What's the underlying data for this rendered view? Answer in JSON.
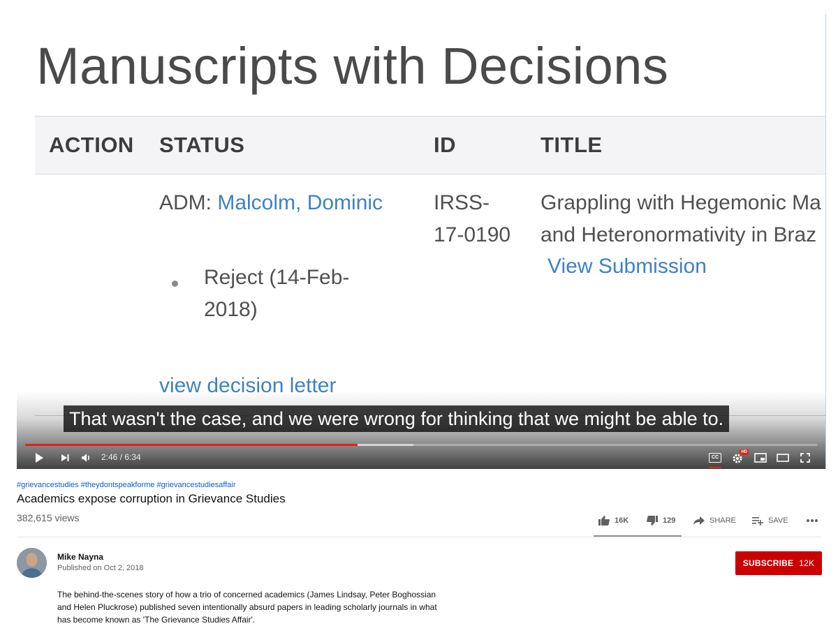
{
  "video": {
    "frame": {
      "heading": "Manuscripts with Decisions",
      "columns": [
        "ACTION",
        "STATUS",
        "ID",
        "TITLE"
      ],
      "row": {
        "status_prefix": "ADM: ",
        "status_name": "Malcolm, Dominic",
        "decision_line1": "Reject (14-Feb-",
        "decision_line2": "2018)",
        "decision_link": "view decision letter",
        "id_line1": "IRSS-",
        "id_line2": "17-0190",
        "title_line1": "Grappling with Hegemonic Ma",
        "title_line2": "and Heteronormativity in Braz",
        "title_link": "View Submission"
      }
    },
    "caption": "That wasn't the case, and we were wrong for thinking that we might be able to.",
    "time": "2:46 / 6:34",
    "progress_played_fraction": 0.42,
    "progress_buffered_fraction": 0.49,
    "controls": {
      "play_icon": "play-icon",
      "next_icon": "next-icon",
      "volume_icon": "volume-icon",
      "cc_label": "CC",
      "hd_label": "HD",
      "settings_icon": "gear-icon",
      "miniplayer_icon": "miniplayer-icon",
      "theater_icon": "theater-icon",
      "fullscreen_icon": "fullscreen-icon"
    },
    "accent_color": "#e62117"
  },
  "info": {
    "hashtags": "#grievancestudies #theydontspeakforme #grievancestudiesaffair",
    "title": "Academics expose corruption in Grievance Studies",
    "views": "382,615 views",
    "actions": {
      "likes": "16K",
      "dislikes": "129",
      "share": "SHARE",
      "save": "SAVE"
    }
  },
  "channel": {
    "name": "Mike Nayna",
    "published": "Published on Oct 2, 2018",
    "subscribe_label": "SUBSCRIBE",
    "subscriber_count": "12K",
    "subscribe_color": "#cc0000"
  },
  "description": "The behind-the-scenes story of how a trio of concerned academics (James Lindsay, Peter Boghossian and Helen Pluckrose) published seven intentionally absurd papers in leading scholarly journals in what has become known as 'The Grievance Studies Affair'."
}
